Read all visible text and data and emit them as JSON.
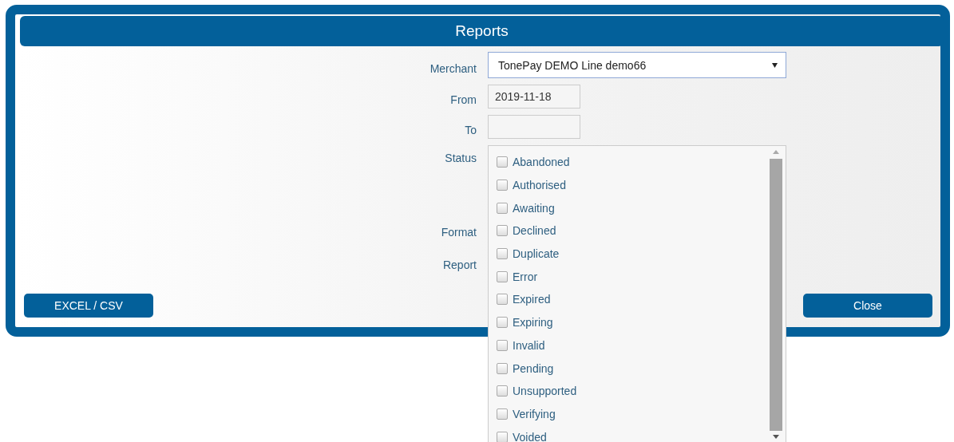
{
  "dialog": {
    "title": "Reports"
  },
  "form": {
    "merchant": {
      "label": "Merchant",
      "value": "TonePay DEMO Line demo66"
    },
    "from": {
      "label": "From",
      "value": "2019-11-18"
    },
    "to": {
      "label": "To"
    },
    "status": {
      "label": "Status",
      "options": [
        {
          "label": "Abandoned",
          "checked": false
        },
        {
          "label": "Authorised",
          "checked": false
        },
        {
          "label": "Awaiting",
          "checked": false
        },
        {
          "label": "Declined",
          "checked": false
        },
        {
          "label": "Duplicate",
          "checked": false
        },
        {
          "label": "Error",
          "checked": false
        },
        {
          "label": "Expired",
          "checked": false
        },
        {
          "label": "Expiring",
          "checked": false
        },
        {
          "label": "Invalid",
          "checked": false
        },
        {
          "label": "Pending",
          "checked": false
        },
        {
          "label": "Unsupported",
          "checked": false
        },
        {
          "label": "Verifying",
          "checked": false
        },
        {
          "label": "Voided",
          "checked": false
        }
      ]
    },
    "format": {
      "label": "Format"
    },
    "report": {
      "label": "Report"
    }
  },
  "buttons": [
    "EXCEL / CSV",
    "Close"
  ]
}
